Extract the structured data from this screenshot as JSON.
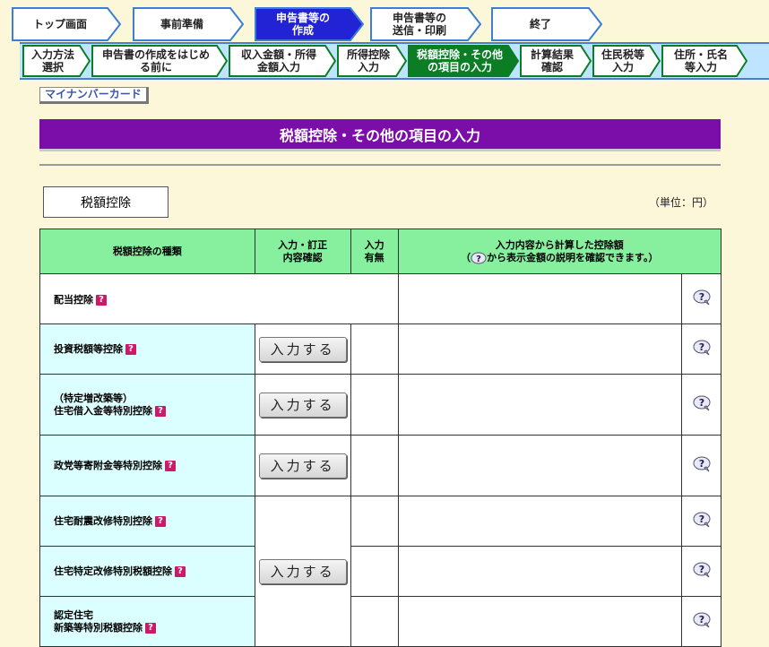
{
  "flow_steps": [
    {
      "label": "トップ画面",
      "active": false
    },
    {
      "label": "事前準備",
      "active": false
    },
    {
      "label": "申告書等の\n作成",
      "active": true
    },
    {
      "label": "申告書等の\n送信・印刷",
      "active": false
    },
    {
      "label": "終了",
      "active": false
    }
  ],
  "sub_steps": [
    {
      "label": "入力方法\n選択",
      "active": false
    },
    {
      "label": "申告書の作成をはじめ\nる前に",
      "active": false
    },
    {
      "label": "収入金額・所得\n金額入力",
      "active": false
    },
    {
      "label": "所得控除\n入力",
      "active": false
    },
    {
      "label": "税額控除・その他\nの項目の入力",
      "active": true
    },
    {
      "label": "計算結果\n確認",
      "active": false
    },
    {
      "label": "住民税等\n入力",
      "active": false
    },
    {
      "label": "住所・氏名\n等入力",
      "active": false
    }
  ],
  "mynumber_label": "マイナンバーカード",
  "page_title": "税額控除・その他の項目の入力",
  "section_label": "税額控除",
  "unit_label": "（単位：円）",
  "table": {
    "col_type": "税額控除の種類",
    "col_input": "入力・訂正\n内容確認",
    "col_status": "入力\n有無",
    "col_amount_line1": "入力内容から計算した控除額",
    "col_amount_line2_pre": "（",
    "col_amount_line2_post": "から表示金額の説明を確認できます。）",
    "input_button_label": "入力する",
    "rows": [
      {
        "name": "配当控除"
      },
      {
        "name": "投資税額等控除"
      },
      {
        "name": "（特定増改築等）\n住宅借入金等特別控除"
      },
      {
        "name": "政党等寄附金等特別控除"
      },
      {
        "name": "住宅耐震改修特別控除"
      },
      {
        "name": "住宅特定改修特別税額控除"
      },
      {
        "name": "認定住宅\n新築等特別税額控除"
      }
    ]
  },
  "colors": {
    "active_step": "#2323d6",
    "active_substep": "#0b7d25",
    "title_band": "#7b0ea8",
    "table_header": "#86f09e",
    "row_name_bg": "#dbfeff"
  }
}
